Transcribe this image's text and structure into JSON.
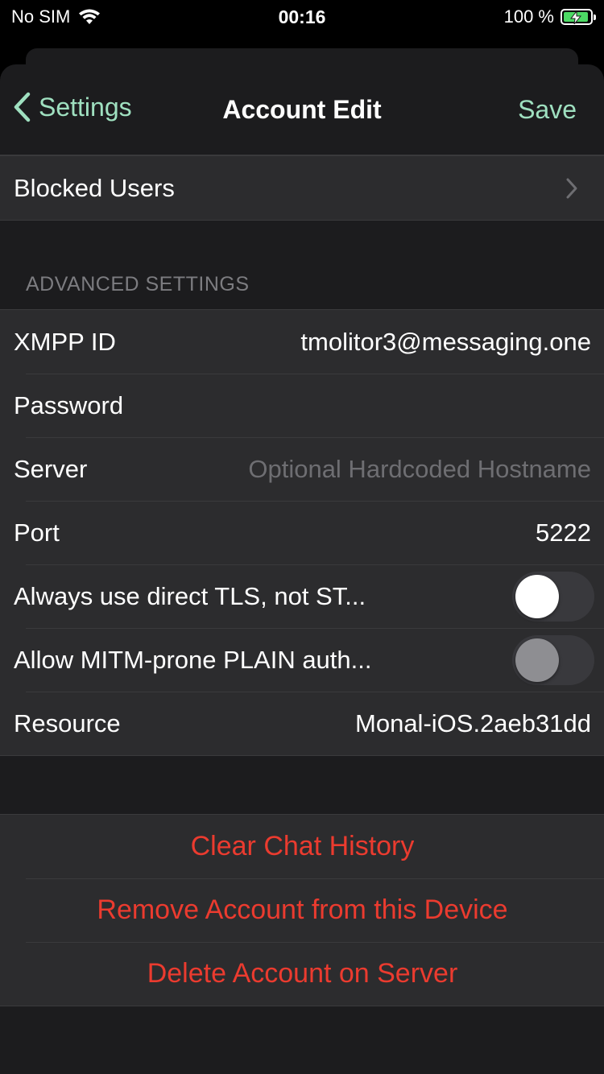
{
  "status_bar": {
    "carrier": "No SIM",
    "time": "00:16",
    "battery_percent": "100 %",
    "icons": [
      "wifi-icon",
      "battery-charging-icon"
    ],
    "battery_color": "#4cd964"
  },
  "nav": {
    "back_label": "Settings",
    "title": "Account Edit",
    "save_label": "Save",
    "accent_color": "#9fe0c0"
  },
  "blocked_users": {
    "label": "Blocked Users"
  },
  "advanced": {
    "header": "ADVANCED SETTINGS",
    "xmpp_id": {
      "label": "XMPP ID",
      "value": "tmolitor3@messaging.one"
    },
    "password": {
      "label": "Password",
      "value": ""
    },
    "server": {
      "label": "Server",
      "placeholder": "Optional Hardcoded Hostname"
    },
    "port": {
      "label": "Port",
      "value": "5222"
    },
    "direct_tls": {
      "label": "Always use direct TLS, not ST...",
      "on": false
    },
    "plain_auth": {
      "label": "Allow MITM-prone PLAIN auth...",
      "on": false,
      "enabled": false
    },
    "resource": {
      "label": "Resource",
      "value": "Monal-iOS.2aeb31dd"
    }
  },
  "actions": {
    "clear_history": "Clear Chat History",
    "remove_account": "Remove Account from this Device",
    "delete_account": "Delete Account on Server",
    "destructive_color": "#eb3b2f"
  }
}
